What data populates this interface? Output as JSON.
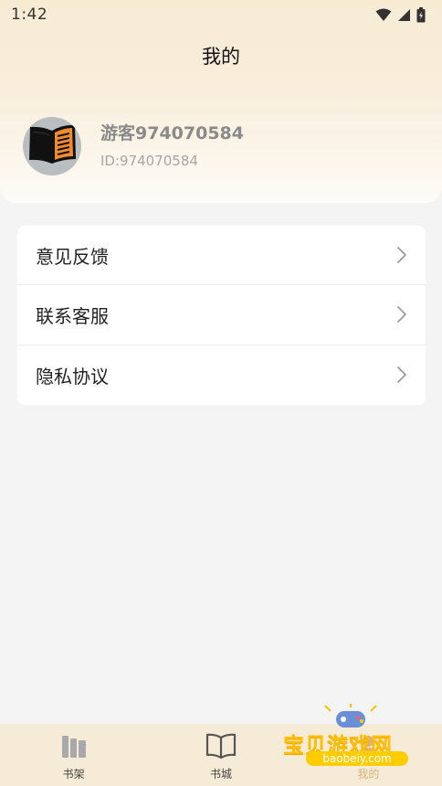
{
  "status_bar": {
    "time": "1:42",
    "icons": [
      "wifi-icon",
      "signal-icon",
      "battery-icon"
    ]
  },
  "header": {
    "title": "我的"
  },
  "profile": {
    "name": "游客974070584",
    "id": "ID:974070584",
    "avatar": "book-icon"
  },
  "menu": {
    "items": [
      {
        "label": "意见反馈",
        "icon": "chevron-right-icon"
      },
      {
        "label": "联系客服",
        "icon": "chevron-right-icon"
      },
      {
        "label": "隐私协议",
        "icon": "chevron-right-icon"
      }
    ]
  },
  "bottom_nav": {
    "items": [
      {
        "label": "书架",
        "icon": "bookshelf-icon",
        "active": false
      },
      {
        "label": "书城",
        "icon": "open-book-icon",
        "active": false
      },
      {
        "label": "我的",
        "icon": "profile-icon",
        "active": true
      }
    ]
  },
  "watermark": {
    "text": "宝贝游戏网",
    "url": "baobeiy.com"
  },
  "colors": {
    "header_gradient_top": "#f7ebd4",
    "nav_background": "#f6ebd6",
    "active_tab": "#d8b27a",
    "page_background": "#f4f4f4"
  }
}
